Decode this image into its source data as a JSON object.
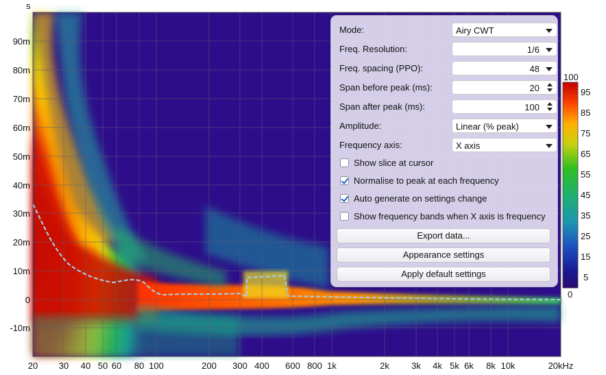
{
  "plot": {
    "y_unit": "s",
    "y_ticks": [
      "90m",
      "80m",
      "70m",
      "60m",
      "50m",
      "40m",
      "30m",
      "20m",
      "10m",
      "0",
      "-10m"
    ],
    "x_ticks": [
      "20",
      "30",
      "40",
      "50",
      "60",
      "80",
      "100",
      "200",
      "300",
      "400",
      "600",
      "800",
      "1k",
      "2k",
      "3k",
      "4k",
      "5k",
      "6k",
      "8k",
      "10k",
      "20kHz"
    ]
  },
  "colorbar": {
    "top_label": "100",
    "bottom_label": "0",
    "ticks": [
      "95",
      "85",
      "75",
      "65",
      "55",
      "45",
      "35",
      "25",
      "15",
      "5"
    ]
  },
  "panel": {
    "mode": {
      "label": "Mode:",
      "value": "Airy CWT"
    },
    "freq_resolution": {
      "label": "Freq. Resolution:",
      "value": "1/6"
    },
    "freq_spacing": {
      "label": "Freq. spacing (PPO):",
      "value": "48"
    },
    "span_before": {
      "label": "Span before peak (ms):",
      "value": "20"
    },
    "span_after": {
      "label": "Span after peak (ms):",
      "value": "100"
    },
    "amplitude": {
      "label": "Amplitude:",
      "value": "Linear (% peak)"
    },
    "freq_axis": {
      "label": "Frequency axis:",
      "value": "X axis"
    },
    "show_slice": {
      "label": "Show slice at cursor",
      "checked": false
    },
    "normalise": {
      "label": "Normalise to peak at each frequency",
      "checked": true
    },
    "auto_generate": {
      "label": "Auto generate on settings change",
      "checked": true
    },
    "show_bands": {
      "label": "Show frequency bands when X axis is frequency",
      "checked": false
    },
    "export_btn": "Export data...",
    "appearance_btn": "Appearance settings",
    "defaults_btn": "Apply default settings"
  }
}
